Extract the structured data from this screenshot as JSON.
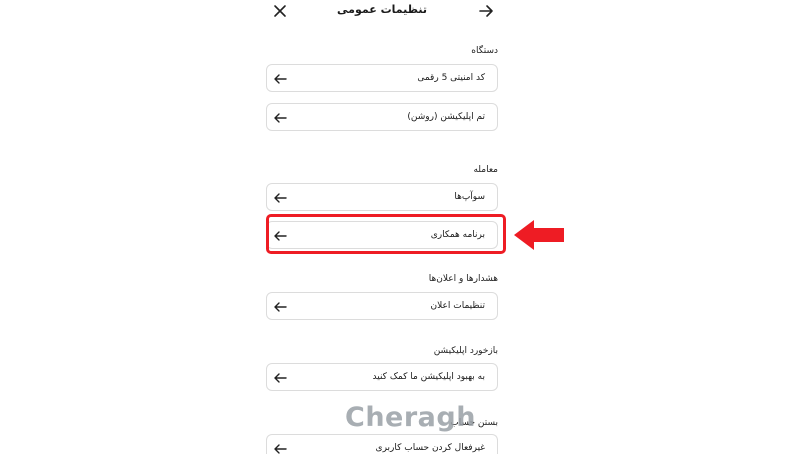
{
  "header": {
    "title": "تنظیمات عمومی",
    "close_icon": "close-icon",
    "back_icon": "arrow-right-icon"
  },
  "sections": [
    {
      "title": "دستگاه",
      "items": [
        {
          "label": "کد امنیتی 5 رقمی"
        },
        {
          "label": "تم اپلیکیشن (روشن)"
        }
      ]
    },
    {
      "title": "معامله",
      "items": [
        {
          "label": "سوآپ‌ها"
        },
        {
          "label": "برنامه همکاری"
        }
      ]
    },
    {
      "title": "هشدارها و اعلان‌ها",
      "items": [
        {
          "label": "تنظیمات اعلان"
        }
      ]
    },
    {
      "title": "بازخورد اپلیکیشن",
      "items": [
        {
          "label": "به بهبود اپلیکیشن ما کمک کنید"
        }
      ]
    },
    {
      "title": "بستن حساب",
      "items": [
        {
          "label": "غیرفعال کردن حساب کاربری"
        }
      ]
    }
  ],
  "row_icon": "arrow-left-icon",
  "annotation": {
    "highlight_color": "#ee1c24",
    "pointer_icon": "red-arrow-left-icon"
  },
  "watermark": "Cheragh"
}
